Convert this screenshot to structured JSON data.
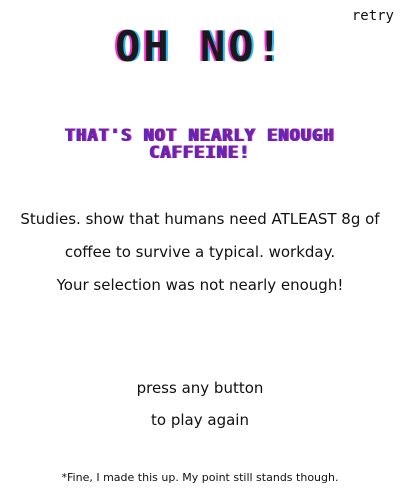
{
  "retry_label": "retry",
  "headline": "OH NO!",
  "subhead": {
    "line1": "THAT'S NOT NEARLY ENOUGH",
    "line2": "CAFFEINE!"
  },
  "message": {
    "line1": "Studies. show that humans  need ATLEAST 8g of",
    "line2": "coffee to survive a typical. workday.",
    "line3": "Your selection was not nearly enough!"
  },
  "prompt": {
    "line1": "press any button",
    "line2": "to play again"
  },
  "footnote": "*Fine, I made this up. My point still stands though.",
  "colors": {
    "headline_shadow_left": "#ff2bd6",
    "headline_shadow_right": "#2bb8ff",
    "subhead": "#7a1fa0"
  }
}
